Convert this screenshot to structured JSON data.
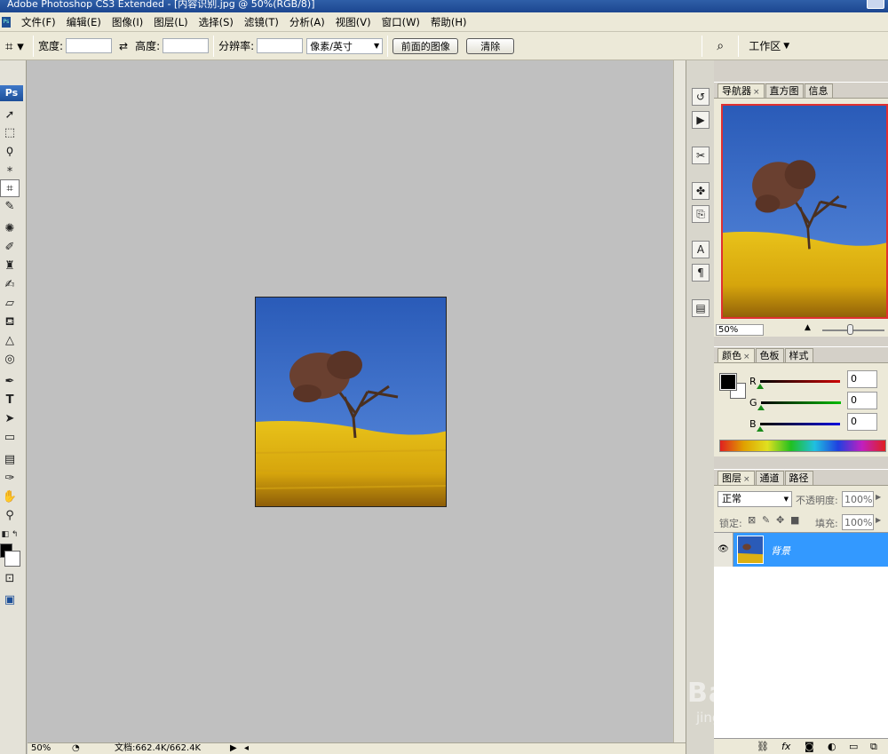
{
  "window": {
    "title": "Adobe Photoshop CS3 Extended - [内容识别.jpg @ 50%(RGB/8)]"
  },
  "menu": [
    "文件(F)",
    "编辑(E)",
    "图像(I)",
    "图层(L)",
    "选择(S)",
    "滤镜(T)",
    "分析(A)",
    "视图(V)",
    "窗口(W)",
    "帮助(H)"
  ],
  "options_bar": {
    "width_label": "宽度:",
    "height_label": "高度:",
    "resolution_label": "分辨率:",
    "unit_value": "像素/英寸",
    "front_image_button": "前面的图像",
    "clear_button": "清除",
    "workspace_label": "工作区"
  },
  "toolbox": {
    "logo": "Ps"
  },
  "document": {
    "zoom": "50%",
    "doc_size": "文档:662.4K/662.4K"
  },
  "navigator": {
    "tabs": [
      "导航器",
      "直方图",
      "信息"
    ],
    "zoom": "50%"
  },
  "color_panel": {
    "tabs": [
      "颜色",
      "色板",
      "样式"
    ],
    "channels": [
      {
        "name": "R",
        "value": "0",
        "color": "#cc0000"
      },
      {
        "name": "G",
        "value": "0",
        "color": "#00aa00"
      },
      {
        "name": "B",
        "value": "0",
        "color": "#0000cc"
      }
    ]
  },
  "layers_panel": {
    "tabs": [
      "图层",
      "通道",
      "路径"
    ],
    "blend_mode": "正常",
    "opacity_label": "不透明度:",
    "opacity_value": "100%",
    "lock_label": "锁定:",
    "fill_label": "填充:",
    "fill_value": "100%",
    "layers": [
      {
        "name": "背景",
        "selected": true
      }
    ]
  },
  "watermark": {
    "text": "Baidu经验",
    "url": "jingyan.baidu.com"
  },
  "colors": {
    "accent": "#3399ff",
    "title_bar": "#2f5fa8",
    "canvas_bg": "#c0c0c0",
    "foreground": "#000000",
    "background": "#ffffff"
  }
}
